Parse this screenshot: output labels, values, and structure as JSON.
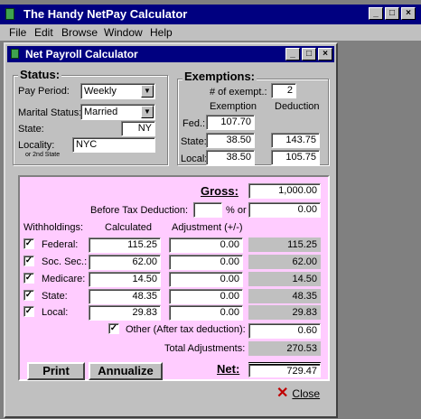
{
  "outer": {
    "title": "The Handy NetPay Calculator",
    "menu": [
      "File",
      "Edit",
      "Browse",
      "Window",
      "Help"
    ]
  },
  "inner": {
    "title": "Net Payroll Calculator"
  },
  "status": {
    "heading": "Status:",
    "pay_period_label": "Pay Period:",
    "pay_period_value": "Weekly",
    "marital_label": "Marital Status:",
    "marital_value": "Married",
    "state_label": "State:",
    "state_value": "NY",
    "locality_label": "Locality:",
    "locality_sub": "or 2nd State",
    "locality_value": "NYC"
  },
  "exemptions": {
    "heading": "Exemptions:",
    "num_label": "# of exempt.:",
    "num_value": "2",
    "col_exemption": "Exemption",
    "col_deduction": "Deduction",
    "rows": [
      {
        "label": "Fed.:",
        "exemption": "107.70",
        "deduction": ""
      },
      {
        "label": "State:",
        "exemption": "38.50",
        "deduction": "143.75"
      },
      {
        "label": "Local:",
        "exemption": "38.50",
        "deduction": "105.75"
      }
    ]
  },
  "pay": {
    "gross_label": "Gross:",
    "gross_value": "1,000.00",
    "before_tax_label": "Before Tax Deduction:",
    "before_tax_pct": "",
    "pct_or": "% or",
    "before_tax_amount": "0.00",
    "withholdings_label": "Withholdings:",
    "col_calculated": "Calculated",
    "col_adjustment": "Adjustment (+/-)",
    "rows": [
      {
        "label": "Federal:",
        "checked": true,
        "calculated": "115.25",
        "adjustment": "0.00",
        "total": "115.25"
      },
      {
        "label": "Soc. Sec.:",
        "checked": true,
        "calculated": "62.00",
        "adjustment": "0.00",
        "total": "62.00"
      },
      {
        "label": "Medicare:",
        "checked": true,
        "calculated": "14.50",
        "adjustment": "0.00",
        "total": "14.50"
      },
      {
        "label": "State:",
        "checked": true,
        "calculated": "48.35",
        "adjustment": "0.00",
        "total": "48.35"
      },
      {
        "label": "Local:",
        "checked": true,
        "calculated": "29.83",
        "adjustment": "0.00",
        "total": "29.83"
      }
    ],
    "other_label": "Other (After tax deduction):",
    "other_value": "0.60",
    "total_adj_label": "Total Adjustments:",
    "total_adj_value": "270.53",
    "net_label": "Net:",
    "net_value": "729.47",
    "print_label": "Print",
    "annualize_label": "Annualize"
  },
  "close_label": "Close",
  "check_glyph": "✓"
}
